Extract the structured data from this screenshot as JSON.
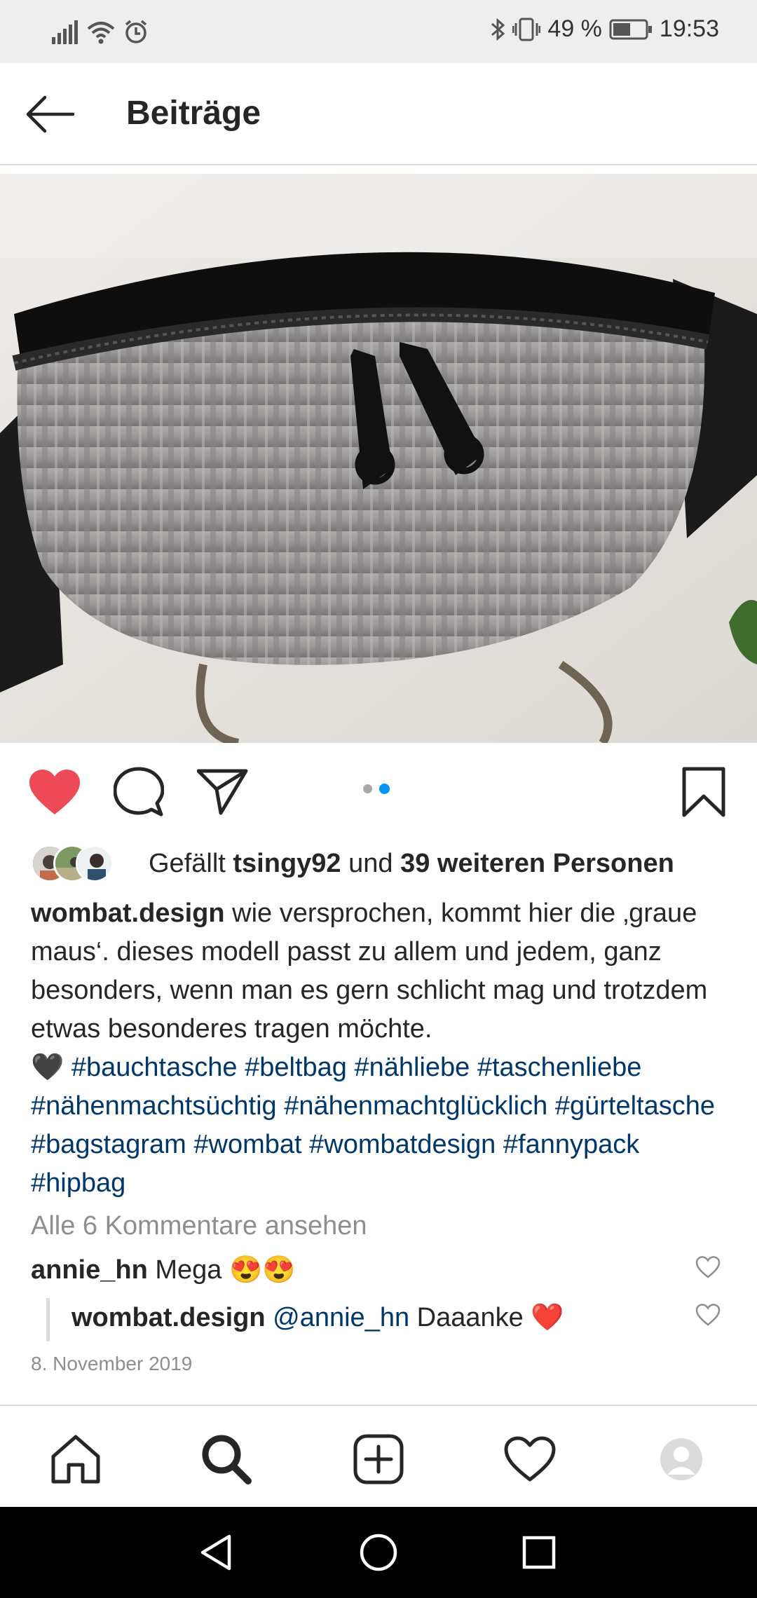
{
  "status_bar": {
    "battery_percent": "49 %",
    "time": "19:53"
  },
  "header": {
    "title": "Beiträge"
  },
  "post": {
    "carousel": {
      "count": 2,
      "active_index": 1
    },
    "likes": {
      "prefix": "Gefällt",
      "user": "tsingy92",
      "conjunction": "und",
      "others": "39 weiteren Personen"
    },
    "caption": {
      "author": "wombat.design",
      "text": "wie versprochen, kommt hier die ‚graue maus‘. dieses modell passt zu allem und jedem, ganz besonders, wenn man es gern schlicht mag und trotzdem etwas besonderes tragen möchte.",
      "emoji": "🖤",
      "hashtags": [
        "#bauchtasche",
        "#beltbag",
        "#nähliebe",
        "#taschenliebe",
        "#nähenmachtsüchtig",
        "#nähenmachtglücklich",
        "#gürteltasche",
        "#bagstagram",
        "#wombat",
        "#wombatdesign",
        "#fannypack",
        "#hipbag"
      ]
    },
    "view_all_comments": "Alle 6 Kommentare ansehen",
    "comments": [
      {
        "user": "annie_hn",
        "text": "Mega 😍😍"
      },
      {
        "user": "wombat.design",
        "mention": "@annie_hn",
        "text": "Daaanke ❤️"
      }
    ],
    "date": "8. November 2019"
  },
  "colors": {
    "like_red": "#ed4956",
    "hashtag_blue": "#00376b",
    "carousel_active": "#0095f6"
  },
  "icons": {
    "header": [
      "back-arrow-icon"
    ],
    "actions": [
      "heart-filled-icon",
      "comment-icon",
      "share-icon",
      "bookmark-icon"
    ],
    "bottom_nav": [
      "home-icon",
      "search-icon",
      "add-post-icon",
      "activity-heart-icon",
      "profile-avatar-icon"
    ],
    "system_nav": [
      "back-triangle-icon",
      "home-circle-icon",
      "recents-square-icon"
    ]
  }
}
